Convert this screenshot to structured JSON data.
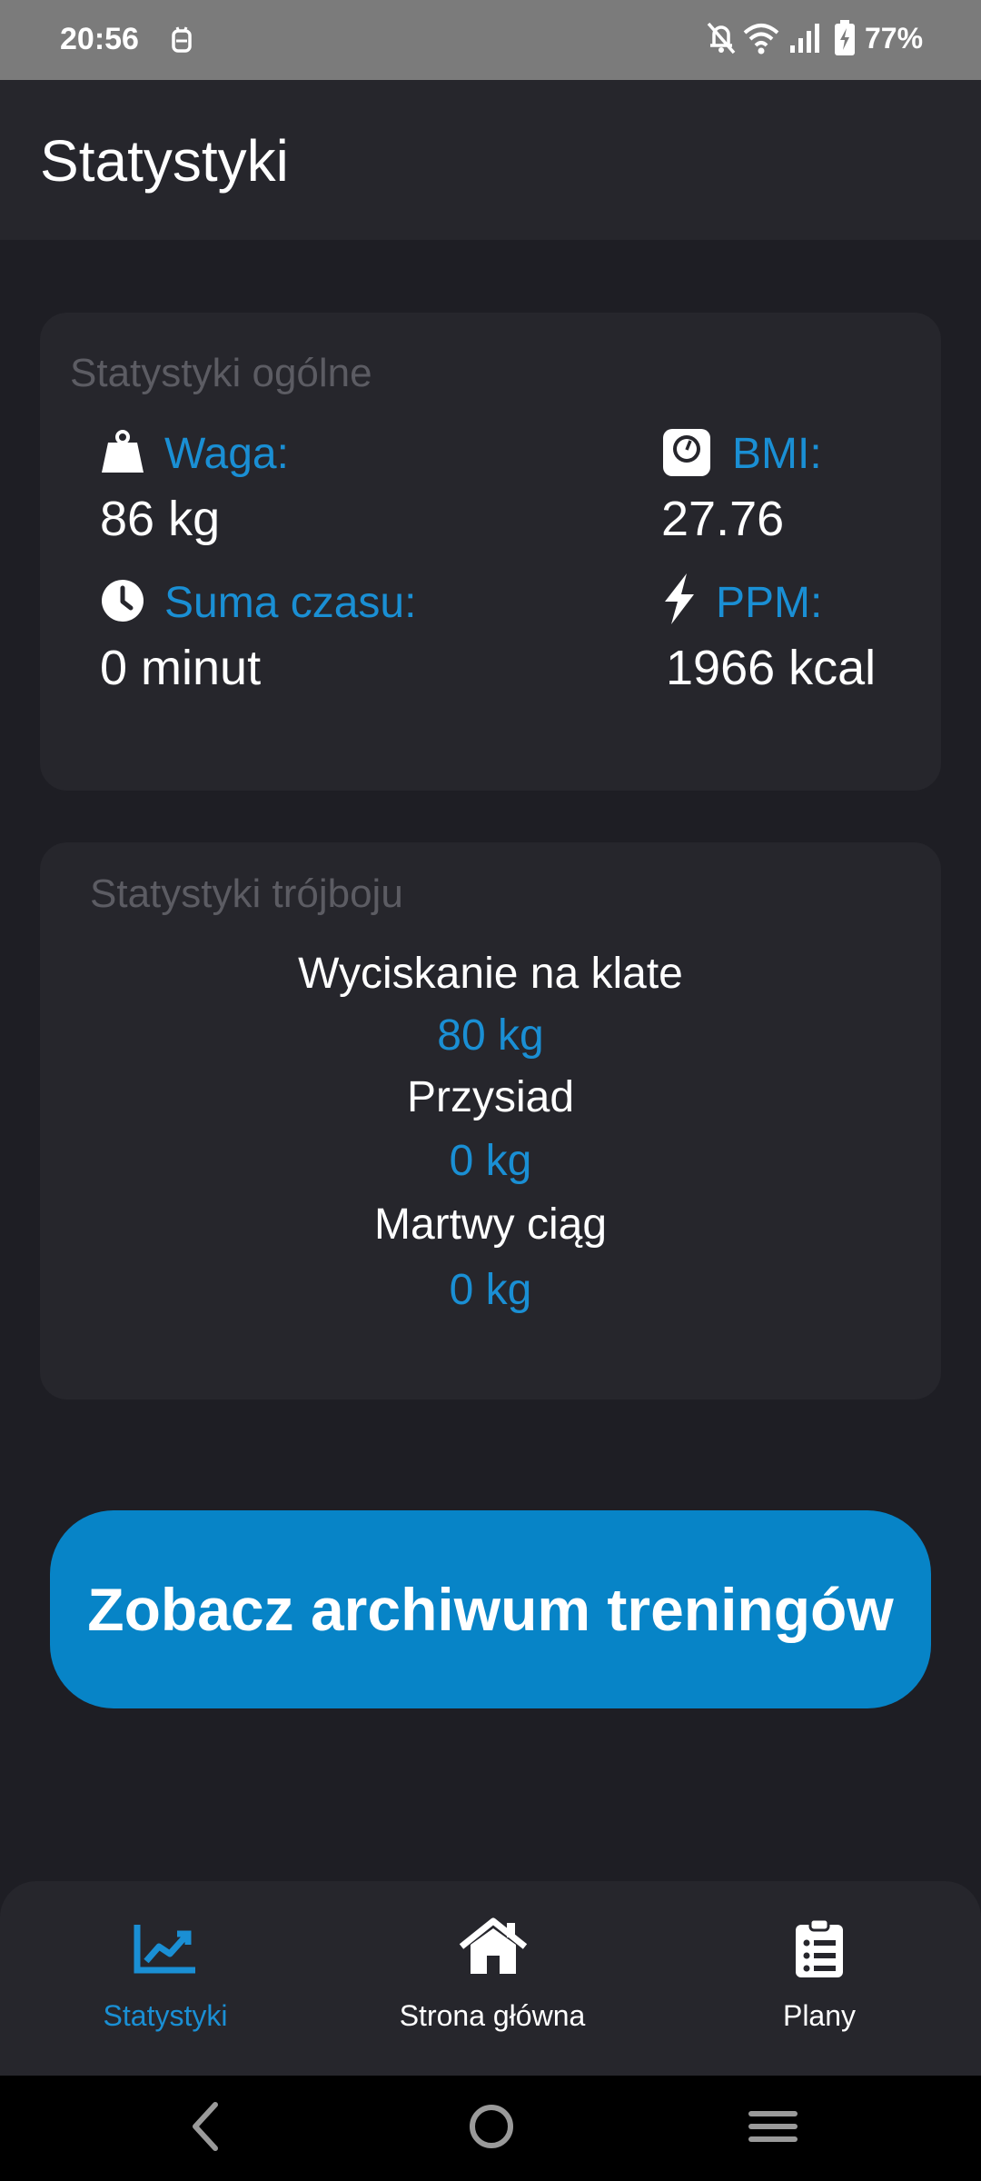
{
  "status_bar": {
    "time": "20:56",
    "battery": "77%",
    "icons": [
      "notification-app-icon",
      "bell-off-icon",
      "wifi-icon",
      "signal-icon",
      "battery-charging-icon"
    ]
  },
  "app_bar": {
    "title": "Statystyki"
  },
  "general_stats": {
    "title": "Statystyki ogólne",
    "weight": {
      "label": "Waga:",
      "value": "86 kg",
      "icon": "weight-icon"
    },
    "bmi": {
      "label": "BMI:",
      "value": "27.76",
      "icon": "scale-icon"
    },
    "total_time": {
      "label": "Suma czasu:",
      "value": "0 minut",
      "icon": "clock-icon"
    },
    "ppm": {
      "label": "PPM:",
      "value": "1966 kcal",
      "icon": "lightning-icon"
    }
  },
  "powerlifting_stats": {
    "title": "Statystyki trójboju",
    "lifts": [
      {
        "name": "Wyciskanie na klate",
        "value": "80 kg"
      },
      {
        "name": "Przysiad",
        "value": "0 kg"
      },
      {
        "name": "Martwy ciąg",
        "value": "0 kg"
      }
    ]
  },
  "archive_button": {
    "label": "Zobacz archiwum treningów"
  },
  "bottom_nav": {
    "items": [
      {
        "label": "Statystyki",
        "icon": "chart-icon",
        "active": true
      },
      {
        "label": "Strona główna",
        "icon": "home-icon",
        "active": false
      },
      {
        "label": "Plany",
        "icon": "clipboard-icon",
        "active": false
      }
    ]
  },
  "colors": {
    "accent": "#1a8fd4",
    "button": "#0784c7",
    "background": "#1e1e24",
    "card": "#26262c",
    "status_bar": "#7b7b7b"
  }
}
